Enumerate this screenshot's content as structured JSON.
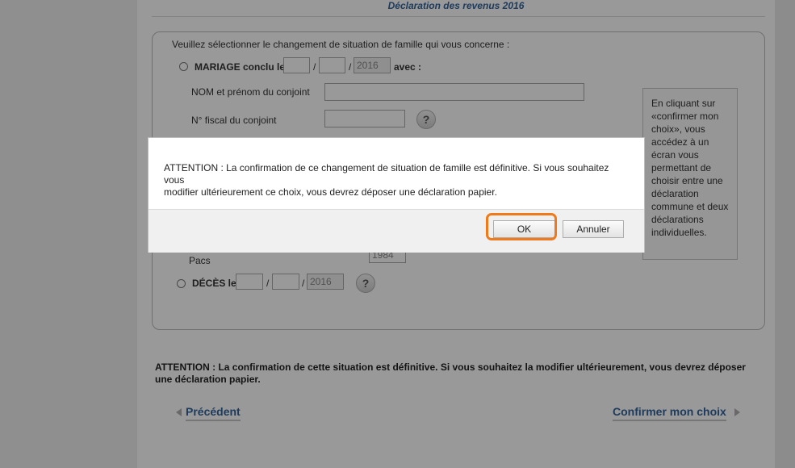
{
  "header": {
    "title": "Déclaration des revenus 2016"
  },
  "form": {
    "intro": "Veuillez sélectionner le changement de situation de famille qui vous concerne :",
    "mariage": {
      "label": "MARIAGE conclu le",
      "sep1": "/",
      "sep2": "/",
      "year_value": "2016",
      "avec": "avec :",
      "nom_label": "NOM et prénom du conjoint",
      "fiscal_label": "N° fiscal du conjoint"
    },
    "pacs": {
      "label": "Pacs",
      "year_value": "1984"
    },
    "deces": {
      "label": "DÉCÈS le",
      "sep1": "/",
      "sep2": "/",
      "year_value": "2016"
    },
    "help_symbol": "?"
  },
  "tip": {
    "text": "En cliquant sur «confirmer mon choix», vous accédez à un écran vous permettant de choisir entre une déclaration commune et deux déclarations individuelles."
  },
  "warning": {
    "bold_prefix": "ATTENTION :",
    "text": " La confirmation de cette situation est définitive. Si vous souhaitez la modifier ultérieurement, vous devrez déposer une déclaration papier."
  },
  "nav": {
    "previous": "Précédent",
    "confirm": "Confirmer mon choix"
  },
  "modal": {
    "message": "ATTENTION : La confirmation de ce changement de situation de famille est définitive. Si vous souhaitez vous\nmodifier ultérieurement ce choix, vous devrez déposer une déclaration papier.",
    "ok_label": "OK",
    "cancel_label": "Annuler"
  },
  "colors": {
    "link": "#35639a",
    "focus": "#f07a1a"
  }
}
